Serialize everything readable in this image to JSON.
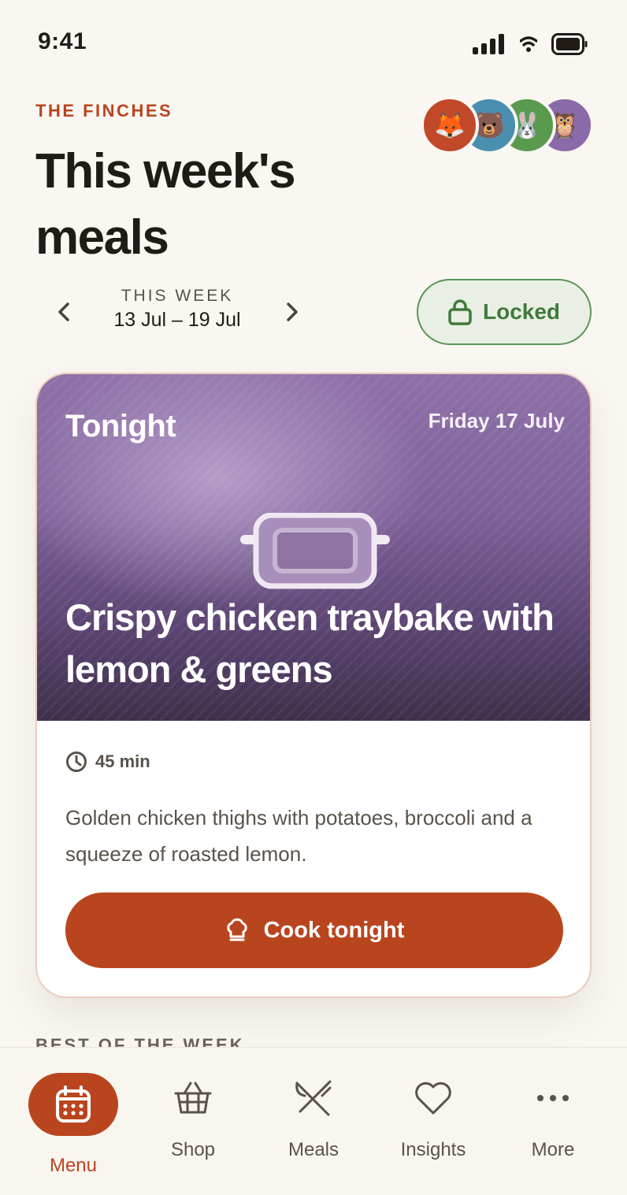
{
  "status_bar": {
    "time": "9:41"
  },
  "header": {
    "household": "THE FINCHES",
    "title": "This week's meals",
    "avatars": [
      {
        "name": "fox",
        "color": "#c2482a",
        "glyph": "🦊"
      },
      {
        "name": "bear",
        "color": "#4a8fb0",
        "glyph": "🐻"
      },
      {
        "name": "rabbit",
        "color": "#5a9a4f",
        "glyph": "🐰"
      },
      {
        "name": "owl",
        "color": "#8a6aa8",
        "glyph": "🦉"
      }
    ]
  },
  "week": {
    "eyebrow": "THIS WEEK",
    "range": "13 Jul – 19 Jul",
    "locked_label": "Locked"
  },
  "tonight_card": {
    "eyebrow": "Tonight",
    "date": "Friday 17 July",
    "title": "Crispy chicken traybake with lemon & greens",
    "duration": "45 min",
    "description": "Golden chicken thighs with potatoes, broccoli and a squeeze of roasted lemon.",
    "cta": "Cook tonight"
  },
  "next_section": {
    "heading": "BEST OF THE WEEK"
  },
  "tab_bar": {
    "items": [
      {
        "label": "Menu",
        "icon": "calendar-icon",
        "active": true
      },
      {
        "label": "Shop",
        "icon": "basket-icon",
        "active": false
      },
      {
        "label": "Meals",
        "icon": "fork-knife-icon",
        "active": false
      },
      {
        "label": "Insights",
        "icon": "heart-icon",
        "active": false
      },
      {
        "label": "More",
        "icon": "more-dots-icon",
        "active": false
      }
    ]
  },
  "colors": {
    "accent": "#b9451f",
    "locked_green": "#3f7a3a",
    "background": "#faf7f2"
  }
}
